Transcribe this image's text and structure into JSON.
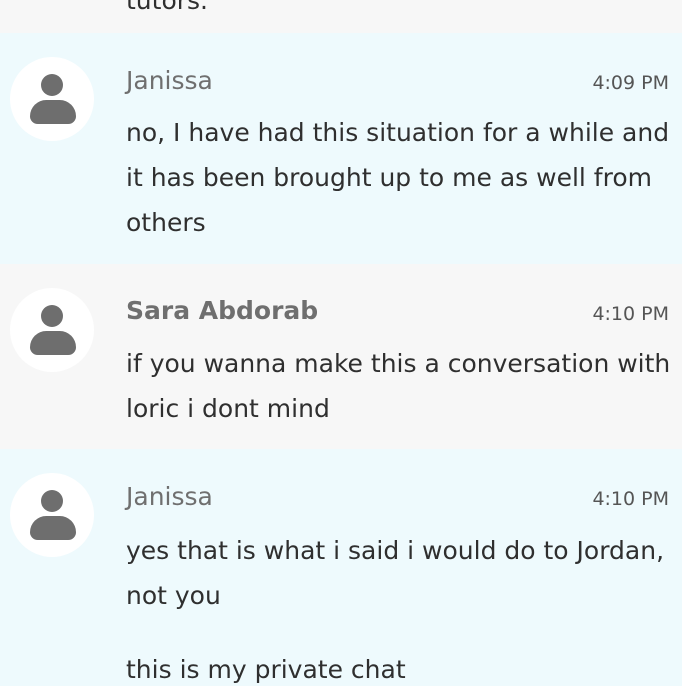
{
  "top_clipped_text": "tutors.",
  "messages": [
    {
      "author": "Janissa",
      "time": "4:09 PM",
      "paragraphs": [
        "no, I have had this situation for a while and it has been brought up to me as well from others"
      ]
    },
    {
      "author": "Sara Abdorab",
      "time": "4:10 PM",
      "paragraphs": [
        "if you wanna make this a conversation with loric i dont mind"
      ]
    },
    {
      "author": "Janissa",
      "time": "4:10 PM",
      "paragraphs": [
        "yes that is what i said i would do to Jordan, not you",
        "this is my private chat"
      ]
    }
  ],
  "colors": {
    "self_background": "#eefafd",
    "other_background": "#f7f7f7",
    "avatar_icon": "#6e6e6e"
  },
  "icons": {
    "avatar": "user-silhouette-icon"
  }
}
